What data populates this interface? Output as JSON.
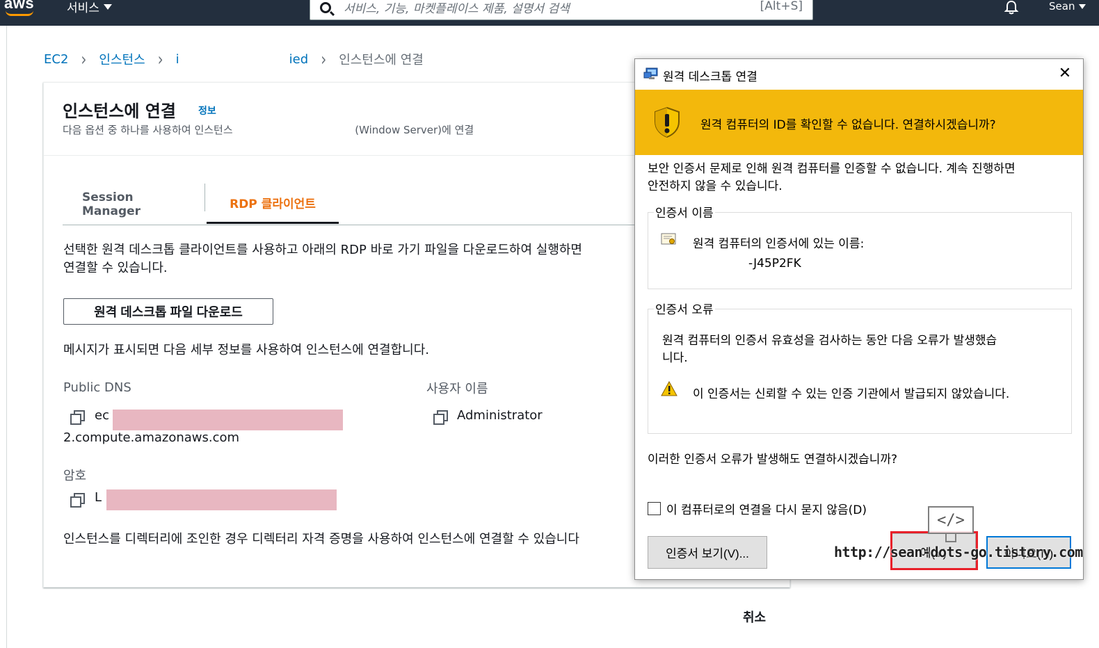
{
  "topbar": {
    "logo": "aws",
    "services_label": "서비스",
    "search_placeholder": "서비스, 기능, 마켓플레이스 제품, 설명서 검색",
    "search_shortcut": "[Alt+S]",
    "user_name": "Sean"
  },
  "breadcrumb": {
    "items": [
      "EC2",
      "인스턴스",
      "i",
      "ied"
    ],
    "current": "인스턴스에 연결"
  },
  "page": {
    "title": "인스턴스에 연결",
    "info_link": "정보",
    "subtitle_prefix": "다음 옵션 중 하나를 사용하여 인스턴스",
    "subtitle_suffix": "(Window Server)에 연결"
  },
  "tabs": [
    {
      "label": "Session Manager",
      "active": false
    },
    {
      "label": "RDP 클라이언트",
      "active": true
    }
  ],
  "rdp": {
    "intro_line1": "선택한 원격 데스크톱 클라이언트를 사용하고 아래의 RDP 바로 가기 파일을 다운로드하여 실행하면",
    "intro_line2": "연결할 수 있습니다.",
    "download_button": "원격 데스크톱 파일 다운로드",
    "prompt_text": "메시지가 표시되면 다음 세부 정보를 사용하여 인스턴스에 연결합니다.",
    "public_dns_label": "Public DNS",
    "public_dns_prefix": "ec",
    "public_dns_suffix": "2.compute.amazonaws.com",
    "username_label": "사용자 이름",
    "username_value": "Administrator",
    "password_label": "암호",
    "password_prefix": "L",
    "directory_text": "인스턴스를 디렉터리에 조인한 경우 디렉터리 자격 증명을 사용하여 인스턴스에 연결할 수 있습니다"
  },
  "cancel_label": "취소",
  "dialog": {
    "title": "원격 데스크톱 연결",
    "banner": "원격 컴퓨터의 ID를 확인할 수 없습니다. 연결하시겠습니까?",
    "desc_line1": "보안 인증서 문제로 인해 원격 컴퓨터를 인증할 수 없습니다. 계속 진행하면",
    "desc_line2": "안전하지 않을 수 있습니다.",
    "cert_name_group": "인증서 이름",
    "cert_name_label": "원격 컴퓨터의 인증서에 있는 이름:",
    "cert_name_value": "-J45P2FK",
    "cert_error_group": "인증서 오류",
    "cert_error_line1": "원격 컴퓨터의 인증서 유효성을 검사하는 동안 다음 오류가 발생했습",
    "cert_error_line2": "니다.",
    "cert_error_detail": "이 인증서는 신뢰할 수 있는 인증 기관에서 발급되지 않았습니다.",
    "question": "이러한 인증서 오류가 발생해도 연결하시겠습니까?",
    "dont_ask_checkbox": "이 컴퓨터로의 연결을 다시 묻지 않음(D)",
    "view_cert_button": "인증서 보기(V)...",
    "yes_button": "예(Y)",
    "no_button": "아니요(N)"
  },
  "watermark": {
    "code_glyph": "</>",
    "url": "http://sean-dots-go.tistory.com"
  }
}
